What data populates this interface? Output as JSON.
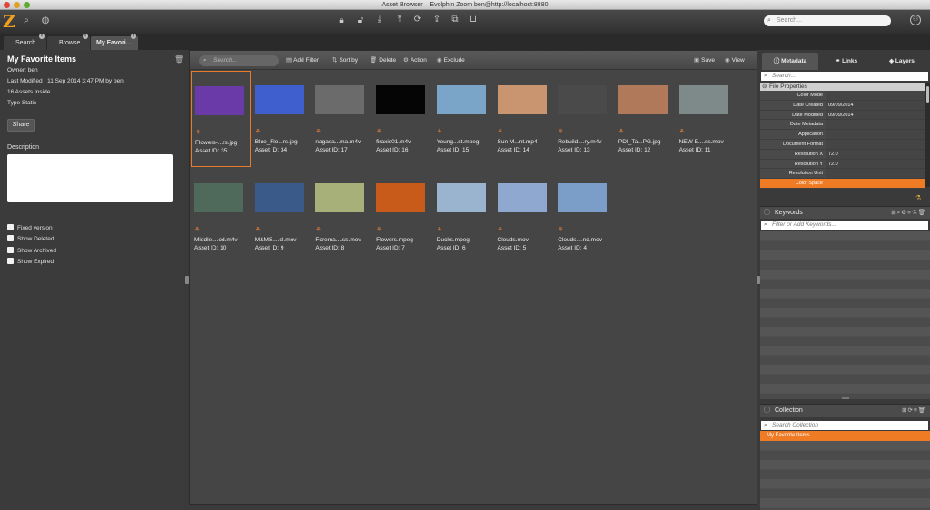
{
  "window": {
    "title": "Asset Browser – Evolphin Zoom ben@http://localhost:8880"
  },
  "toolbar": {
    "logo": "Z",
    "search_placeholder": "Search...",
    "icons": [
      "search-icon",
      "globe-icon",
      "lock-icon",
      "unlock-icon",
      "download-icon",
      "upload-icon",
      "sync-icon",
      "share-icon",
      "copy-icon",
      "cart-icon",
      "user-icon"
    ]
  },
  "tabs": [
    {
      "label": "Search"
    },
    {
      "label": "Browse"
    },
    {
      "label": "My Favori..."
    }
  ],
  "left": {
    "title": "My Favorite Items",
    "owner": "Owner: ben",
    "modified": "Last Modified : 11 Sep 2014 3:47 PM by ben",
    "count": "16 Assets Inside",
    "type": "Type Static",
    "share_label": "Share",
    "description_label": "Description",
    "checkboxes": [
      "Fixed version",
      "Show Deleted",
      "Show Archived",
      "Show Expired"
    ]
  },
  "center": {
    "filter_placeholder": "Search...",
    "buttons": {
      "add_filter": "Add Filter",
      "sort_by": "Sort by",
      "delete": "Delete",
      "action": "Action",
      "exclude": "Exclude",
      "save": "Save",
      "view": "View"
    },
    "assets": [
      {
        "name": "Flowers-...rs.jpg",
        "id": "Asset ID: 35",
        "color": "#6a3aa8"
      },
      {
        "name": "Blue_Flo...rs.jpg",
        "id": "Asset ID: 34",
        "color": "#3f5fcf"
      },
      {
        "name": "nagasa...ma.m4v",
        "id": "Asset ID: 17",
        "color": "#6b6b6b"
      },
      {
        "name": "firaxis01.m4v",
        "id": "Asset ID: 16",
        "color": "#050505"
      },
      {
        "name": "Young...st.mpeg",
        "id": "Asset ID: 15",
        "color": "#7aa4c8"
      },
      {
        "name": "Sun M...nt.mp4",
        "id": "Asset ID: 14",
        "color": "#c89570"
      },
      {
        "name": "Rebuild....ry.m4v",
        "id": "Asset ID: 13",
        "color": "#4a4a4a"
      },
      {
        "name": "PDI_Ta...PG.jpg",
        "id": "Asset ID: 12",
        "color": "#b07a5a"
      },
      {
        "name": "NEW E....ss.mov",
        "id": "Asset ID: 11",
        "color": "#7e8a8a"
      },
      {
        "name": "Middle....od.m4v",
        "id": "Asset ID: 10",
        "color": "#4f6a5a"
      },
      {
        "name": "M&MS....el.mov",
        "id": "Asset ID: 9",
        "color": "#3a5a8a"
      },
      {
        "name": "Forema....ss.mov",
        "id": "Asset ID: 8",
        "color": "#a8b07a"
      },
      {
        "name": "Flowers.mpeg",
        "id": "Asset ID: 7",
        "color": "#c85a1a"
      },
      {
        "name": "Ducks.mpeg",
        "id": "Asset ID: 6",
        "color": "#9ab4d0"
      },
      {
        "name": "Clouds.mov",
        "id": "Asset ID: 5",
        "color": "#8ea8d0"
      },
      {
        "name": "Clouds....nd.mov",
        "id": "Asset ID: 4",
        "color": "#7a9ec8"
      }
    ]
  },
  "right": {
    "tabs": [
      "Metadata",
      "Links",
      "Layers"
    ],
    "search_placeholder": "Search...",
    "file_properties": "File Properties",
    "metadata": [
      {
        "key": "Color Mode",
        "value": ""
      },
      {
        "key": "Date Created",
        "value": "09/09/2014"
      },
      {
        "key": "Date Modified",
        "value": "09/09/2014"
      },
      {
        "key": "Date Metadata",
        "value": ""
      },
      {
        "key": "Application",
        "value": ""
      },
      {
        "key": "Document Format",
        "value": ""
      },
      {
        "key": "Resolution X",
        "value": "72.0"
      },
      {
        "key": "Resolution Y",
        "value": "72.0"
      },
      {
        "key": "Resolution Unit",
        "value": ""
      },
      {
        "key": "Color Space",
        "value": ""
      }
    ],
    "keywords": {
      "label": "Keywords",
      "placeholder": "Filter or Add Keywords..."
    },
    "collection": {
      "label": "Collection",
      "placeholder": "Search Collection",
      "selected": "My Favorite Items"
    }
  },
  "colors": {
    "accent": "#ef7b25",
    "logo": "#f0a020"
  }
}
